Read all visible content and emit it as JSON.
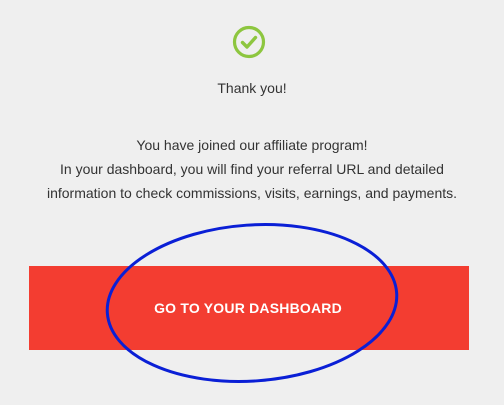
{
  "confirmation": {
    "icon": "check-circle-icon",
    "title": "Thank you!",
    "message_lines": [
      "You have joined our affiliate program!",
      "In your dashboard, you will find your referral URL and detailed",
      "information to check commissions, visits, earnings, and payments."
    ]
  },
  "actions": {
    "dashboard_label": "GO TO YOUR DASHBOARD"
  },
  "annotation": {
    "shape": "ellipse-highlight",
    "target": "dashboard-button"
  },
  "colors": {
    "background": "#efefef",
    "success_green": "#8dc63f",
    "button_red": "#f33d31",
    "text": "#333333",
    "annotation_blue": "#0a1fd6"
  }
}
